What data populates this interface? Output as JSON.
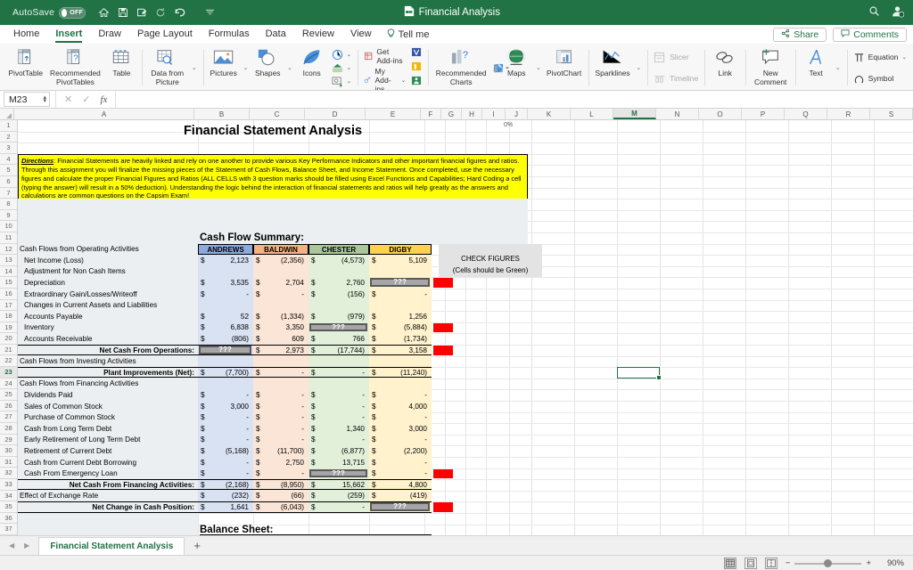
{
  "titlebar": {
    "autosave_label": "AutoSave",
    "autosave_state": "OFF",
    "doc_title": "Financial Analysis",
    "quick_access": [
      "home-icon",
      "save-icon",
      "save-as-icon",
      "refresh-icon",
      "undo-icon",
      "undo-dropdown",
      "qat-more"
    ],
    "search_icon": "search-icon",
    "account_icon": "account-icon"
  },
  "ribbon_tabs": {
    "tabs": [
      "Home",
      "Insert",
      "Draw",
      "Page Layout",
      "Formulas",
      "Data",
      "Review",
      "View"
    ],
    "active": "Insert",
    "tell_me": "Tell me",
    "share": "Share",
    "comments": "Comments"
  },
  "ribbon": {
    "groups": [
      {
        "name": "tables",
        "items": [
          {
            "label": "PivotTable",
            "icon": "pivottable-icon"
          },
          {
            "label": "Recommended PivotTables",
            "icon": "recommended-pivottables-icon"
          },
          {
            "label": "Table",
            "icon": "table-icon"
          }
        ]
      },
      {
        "name": "data-from-picture",
        "items": [
          {
            "label": "Data from Picture",
            "icon": "data-from-picture-icon"
          }
        ]
      },
      {
        "name": "illustrations",
        "items": [
          {
            "label": "Pictures",
            "icon": "pictures-icon"
          },
          {
            "label": "Shapes",
            "icon": "shapes-icon"
          },
          {
            "label": "Icons",
            "icon": "icons-icon"
          }
        ],
        "stack": [
          "3d-models-icon",
          "smartart-icon",
          "screenshot-icon"
        ]
      },
      {
        "name": "add-ins",
        "items": [],
        "rows": [
          {
            "label": "Get Add-ins",
            "icon": "get-addins-icon"
          },
          {
            "label": "My Add-ins",
            "icon": "my-addins-icon"
          }
        ],
        "stack": [
          "visio-icon",
          "bing-maps-icon",
          "people-graph-icon"
        ]
      },
      {
        "name": "charts",
        "items": [
          {
            "label": "Recommended Charts",
            "icon": "recommended-charts-icon"
          }
        ],
        "chart_icons": [
          "column-chart-icon",
          "line-chart-icon",
          "pie-chart-icon",
          "bar-chart-icon",
          "area-chart-icon",
          "scatter-chart-icon",
          "waterfall-chart-icon",
          "combo-chart-icon"
        ],
        "maps": {
          "label": "Maps",
          "icon": "maps-icon"
        },
        "pivotchart": {
          "label": "PivotChart",
          "icon": "pivotchart-icon"
        }
      },
      {
        "name": "sparklines",
        "items": [
          {
            "label": "Sparklines",
            "icon": "sparklines-icon"
          }
        ]
      },
      {
        "name": "filters",
        "rows": [
          {
            "label": "Slicer",
            "icon": "slicer-icon",
            "disabled": true
          },
          {
            "label": "Timeline",
            "icon": "timeline-icon",
            "disabled": true
          }
        ]
      },
      {
        "name": "links",
        "items": [
          {
            "label": "Link",
            "icon": "link-icon"
          }
        ]
      },
      {
        "name": "comments",
        "items": [
          {
            "label": "New Comment",
            "icon": "new-comment-icon"
          }
        ]
      },
      {
        "name": "text",
        "items": [
          {
            "label": "Text",
            "icon": "text-icon"
          }
        ]
      },
      {
        "name": "symbols",
        "rows": [
          {
            "label": "Equation",
            "icon": "equation-icon"
          },
          {
            "label": "Symbol",
            "icon": "symbol-icon"
          }
        ]
      }
    ]
  },
  "formula_bar": {
    "name_box": "M23",
    "cancel_icon": "cancel-icon",
    "enter_icon": "enter-icon",
    "fx_icon": "function-icon",
    "formula_value": ""
  },
  "grid": {
    "columns": [
      "A",
      "B",
      "C",
      "D",
      "E",
      "F",
      "G",
      "H",
      "I",
      "J",
      "K",
      "L",
      "M",
      "N",
      "O",
      "P",
      "Q",
      "R",
      "S"
    ],
    "selected_column": "M",
    "selected_cell": "M23",
    "rows": [
      "1",
      "2",
      "3",
      "4",
      "5",
      "6",
      "7",
      "8",
      "9",
      "10",
      "11",
      "12",
      "13",
      "14",
      "15",
      "16",
      "17",
      "18",
      "19",
      "20",
      "21",
      "22",
      "23",
      "24",
      "25",
      "26",
      "27",
      "28",
      "29",
      "30",
      "31",
      "32",
      "33",
      "34",
      "35",
      "36",
      "37"
    ],
    "selected_row": "23"
  },
  "sheet": {
    "title": "Financial Statement Analysis",
    "directions_label": "Directions",
    "directions_text": ": Financial Statements are heavily linked and rely on one another to provide various Key Performance Indicators and other important financial figures and ratios. Through this assignment you will finalize the missing pieces of the Statement of Cash Flows, Balance Sheet, and Income Statement. Once completed, use the necessary figures and calculate the proper Financial Figures and Ratios (ALL CELLS with 3 question marks should be filled using Excel Functions and Capabilities; Hard Coding a cell (typing the answer) will result in a 50% deduction). Understanding the logic behind the interaction of financial statements and ratios will help greatly as the answers and calculations are common questions on the Capsim Exam!",
    "cash_flow_heading": "Cash Flow Summary:",
    "balance_sheet_heading": "Balance Sheet:",
    "check_figures_title": "CHECK FIGURES",
    "check_figures_sub": "(Cells should be Green)",
    "company_headers": [
      "ANDREWS",
      "BALDWIN",
      "CHESTER",
      "DIGBY"
    ],
    "company_colors": [
      "#8eaadb",
      "#f4b183",
      "#a9c79b",
      "#ffd24d"
    ],
    "company_fills": [
      "#d9e2f3",
      "#fbe5d6",
      "#e2efd9",
      "#fff2cc"
    ],
    "sections": [
      {
        "row": 12,
        "label": "Cash Flows from Operating Activities",
        "indent": 0,
        "type": "section"
      },
      {
        "row": 13,
        "label": "Net Income (Loss)",
        "indent": 1,
        "values": [
          "2,123",
          "(2,356)",
          "(4,573)",
          "5,109"
        ]
      },
      {
        "row": 14,
        "label": "Adjustment for Non Cash Items",
        "indent": 1,
        "values": [
          "",
          "",
          "",
          ""
        ]
      },
      {
        "row": 15,
        "label": "Depreciation",
        "indent": 1,
        "values": [
          "3,535",
          "2,704",
          "2,760",
          "???"
        ]
      },
      {
        "row": 16,
        "label": "Extraordinary Gain/Losses/Writeoff",
        "indent": 1,
        "values": [
          "-",
          "-",
          "(156)",
          "-"
        ]
      },
      {
        "row": 17,
        "label": "Changes in Current Assets and Liabilities",
        "indent": 1,
        "values": [
          "",
          "",
          "",
          ""
        ]
      },
      {
        "row": 18,
        "label": "Accounts Payable",
        "indent": 1,
        "values": [
          "52",
          "(1,334)",
          "(979)",
          "1,256"
        ]
      },
      {
        "row": 19,
        "label": "Inventory",
        "indent": 1,
        "values": [
          "6,838",
          "3,350",
          "???",
          "(5,884)"
        ]
      },
      {
        "row": 20,
        "label": "Accounts Receivable",
        "indent": 1,
        "values": [
          "(806)",
          "609",
          "766",
          "(1,734)"
        ]
      },
      {
        "row": 21,
        "label": "Net Cash From Operations:",
        "indent": 0,
        "align": "right",
        "bold": true,
        "values": [
          "???",
          "2,973",
          "(17,744)",
          "3,158"
        ]
      },
      {
        "row": 22,
        "label": "Cash Flows from Investing Activities",
        "indent": 0,
        "type": "section"
      },
      {
        "row": 23,
        "label": "Plant Improvements (Net):",
        "indent": 0,
        "align": "right",
        "bold": true,
        "values": [
          "(7,700)",
          "-",
          "-",
          "(11,240)"
        ]
      },
      {
        "row": 24,
        "label": "Cash Flows from Financing Activities",
        "indent": 0,
        "type": "section"
      },
      {
        "row": 25,
        "label": "Dividends Paid",
        "indent": 1,
        "values": [
          "-",
          "-",
          "-",
          "-"
        ]
      },
      {
        "row": 26,
        "label": "Sales of Common Stock",
        "indent": 1,
        "values": [
          "3,000",
          "-",
          "-",
          "4,000"
        ]
      },
      {
        "row": 27,
        "label": "Purchase of Common Stock",
        "indent": 1,
        "values": [
          "-",
          "-",
          "-",
          "-"
        ]
      },
      {
        "row": 28,
        "label": "Cash from Long Term Debt",
        "indent": 1,
        "values": [
          "-",
          "-",
          "1,340",
          "3,000"
        ]
      },
      {
        "row": 29,
        "label": "Early Retirement of Long Term Debt",
        "indent": 1,
        "values": [
          "-",
          "-",
          "-",
          "-"
        ]
      },
      {
        "row": 30,
        "label": "Retirement of Current Debt",
        "indent": 1,
        "values": [
          "(5,168)",
          "(11,700)",
          "(6,877)",
          "(2,200)"
        ]
      },
      {
        "row": 31,
        "label": "Cash from Current Debt Borrowing",
        "indent": 1,
        "values": [
          "-",
          "2,750",
          "13,715",
          "-"
        ]
      },
      {
        "row": 32,
        "label": "Cash From Emergency Loan",
        "indent": 1,
        "values": [
          "-",
          "-",
          "???",
          "-"
        ]
      },
      {
        "row": 33,
        "label": "Net Cash From Financing Activities:",
        "indent": 0,
        "align": "right",
        "bold": true,
        "values": [
          "(2,168)",
          "(8,950)",
          "15,662",
          "4,800"
        ]
      },
      {
        "row": 34,
        "label": "Effect of Exchange Rate",
        "indent": 0,
        "values": [
          "(232)",
          "(66)",
          "(259)",
          "(419)"
        ]
      },
      {
        "row": 35,
        "label": "Net Change in Cash Position:",
        "indent": 0,
        "align": "right",
        "bold": true,
        "values": [
          "1,641",
          "(6,043)",
          "-",
          "???"
        ]
      }
    ],
    "question_marks": "???"
  },
  "sheet_tabs": {
    "prev_icon": "prev-sheet-icon",
    "next_icon": "next-sheet-icon",
    "tabs": [
      "Financial Statement Analysis"
    ],
    "active": "Financial Statement Analysis",
    "add_label": "+"
  },
  "status_bar": {
    "normal_view_icon": "normal-view-icon",
    "page-layout_icon": "page-layout-view-icon",
    "page-break_icon": "page-break-view-icon",
    "zoom_out": "−",
    "zoom_in": "+",
    "zoom_level": "90%"
  }
}
